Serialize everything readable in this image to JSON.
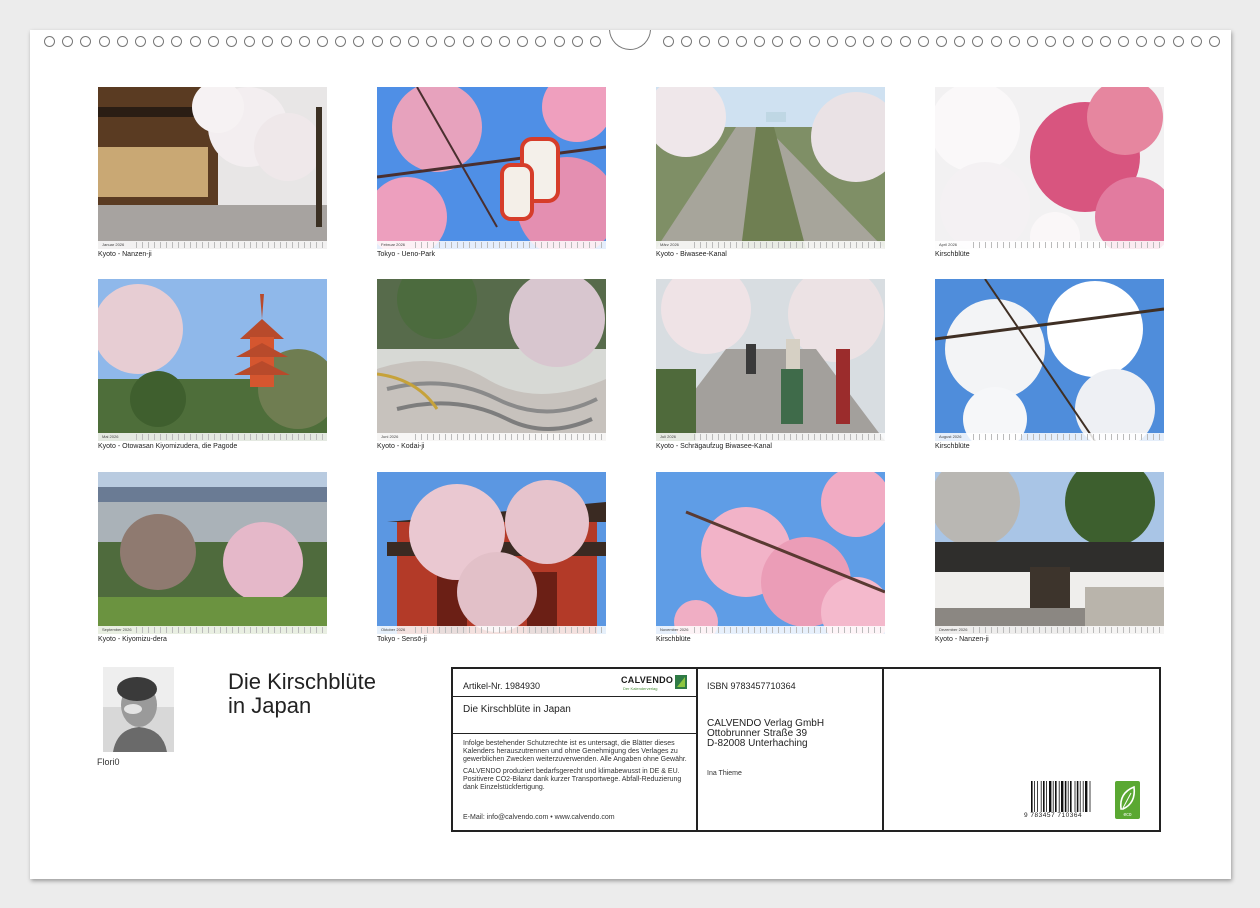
{
  "months": [
    {
      "label": "Januar 2026",
      "caption": "Kyoto - Nanzen-ji",
      "scene": "temple"
    },
    {
      "label": "Februar 2026",
      "caption": "Tokyo - Ueno-Park",
      "scene": "lanterns"
    },
    {
      "label": "März 2026",
      "caption": "Kyoto - Biwasee-Kanal",
      "scene": "canal"
    },
    {
      "label": "April 2026",
      "caption": "Kirschblüte",
      "scene": "pinkwhite"
    },
    {
      "label": "Mai 2026",
      "caption": "Kyoto - Otowasan Kiyomizudera, die Pagode",
      "scene": "pagoda"
    },
    {
      "label": "Juni 2026",
      "caption": "Kyoto - Kodai-ji",
      "scene": "garden"
    },
    {
      "label": "Juli 2026",
      "caption": "Kyoto - Schrägaufzug Biwasee-Kanal",
      "scene": "incline"
    },
    {
      "label": "August 2026",
      "caption": "Kirschblüte",
      "scene": "whiteblossom"
    },
    {
      "label": "September 2026",
      "caption": "Kyoto - Kiyomizu-dera",
      "scene": "cityview"
    },
    {
      "label": "Oktober 2026",
      "caption": "Tokyo - Sensō-ji",
      "scene": "gate"
    },
    {
      "label": "November 2026",
      "caption": "Kirschblüte",
      "scene": "pinksky"
    },
    {
      "label": "Dezember 2026",
      "caption": "Kyoto - Nanzen-ji",
      "scene": "wall"
    }
  ],
  "author": {
    "name": "Flori0"
  },
  "title_line1": "Die Kirschblüte",
  "title_line2": "in Japan",
  "info": {
    "article": "Artikel-Nr. 1984930",
    "brand": "CALVENDO",
    "brand_sub": "Der Kalenderverlag",
    "calendar_title": "Die Kirschblüte in Japan",
    "legal_1": "Infolge bestehender Schutzrechte ist es untersagt, die Blätter dieses Kalenders herauszutrennen und ohne Genehmigung des Verlages zu gewerblichen Zwecken weiterzuverwenden. Alle Angaben ohne Gewähr.",
    "legal_2": "CALVENDO produziert bedarfsgerecht und klimabewusst in DE & EU. Positivere CO2-Bilanz dank kurzer Transportwege. Abfall-Reduzierung dank Einzelstückfertigung.",
    "email": "E-Mail: info@calvendo.com • www.calvendo.com",
    "isbn": "ISBN 9783457710364",
    "publisher_1": "CALVENDO Verlag GmbH",
    "publisher_2": "Ottobrunner Straße 39",
    "publisher_3": "D-82008 Unterhaching",
    "author_small": "Ina Thieme",
    "barcode_number": "9  783457  710364",
    "eco_label": "eco"
  },
  "colors": {
    "border": "#222222",
    "sakura_pink": "#e98db0",
    "sky": "#6fa9e8",
    "eco_green": "#5aa832"
  }
}
